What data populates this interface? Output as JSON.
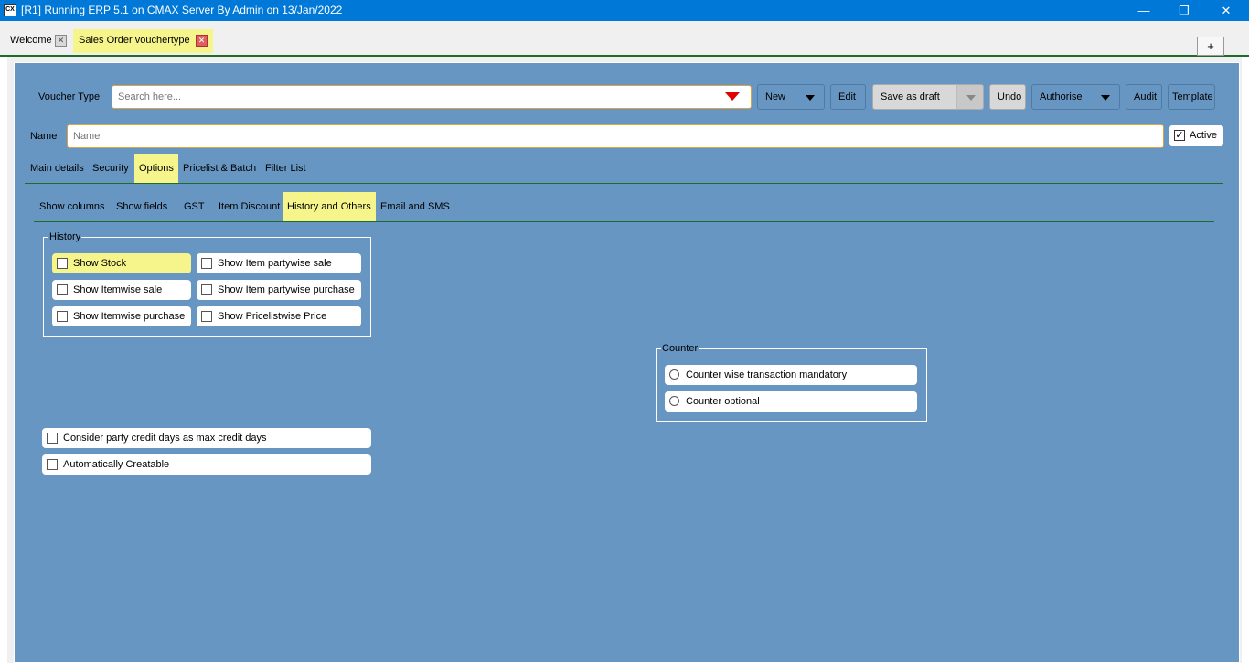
{
  "window": {
    "title": "[R1] Running ERP 5.1 on CMAX Server By Admin on 13/Jan/2022",
    "app_icon_text": "CX",
    "minimize": "—",
    "restore": "❐",
    "close": "✕"
  },
  "tabs": [
    {
      "label": "Welcome",
      "close": "✕"
    },
    {
      "label": "Sales Order vouchertype",
      "close": "✕"
    }
  ],
  "tab_add": "+",
  "voucher": {
    "label": "Voucher Type",
    "search_placeholder": "Search here..."
  },
  "toolbar": {
    "new": "New",
    "edit": "Edit",
    "save_draft": "Save as draft",
    "undo": "Undo",
    "authorise": "Authorise",
    "audit": "Audit",
    "template": "Template"
  },
  "name": {
    "label": "Name",
    "placeholder": "Name",
    "active_label": "Active",
    "active_check": "✓"
  },
  "main_tabs": [
    "Main details",
    "Security",
    "Options",
    "Pricelist & Batch",
    "Filter List"
  ],
  "sub_tabs": [
    "Show columns",
    "Show fields",
    "GST",
    "Item Discount",
    "History and Others",
    "Email and SMS"
  ],
  "history": {
    "title": "History",
    "options": [
      "Show Stock",
      "Show Item partywise sale",
      "Show Itemwise sale",
      "Show Item partywise purchase",
      "Show Itemwise purchase",
      "Show Pricelistwise Price"
    ]
  },
  "counter": {
    "title": "Counter",
    "options": [
      "Counter wise transaction mandatory",
      "Counter optional"
    ]
  },
  "other_options": [
    "Consider party credit days as max credit days",
    "Automatically Creatable"
  ],
  "colors": {
    "accent": "#0078d7",
    "workspace": "#6896c2",
    "highlight": "#f5f58c",
    "divider": "#1e6b2b"
  }
}
